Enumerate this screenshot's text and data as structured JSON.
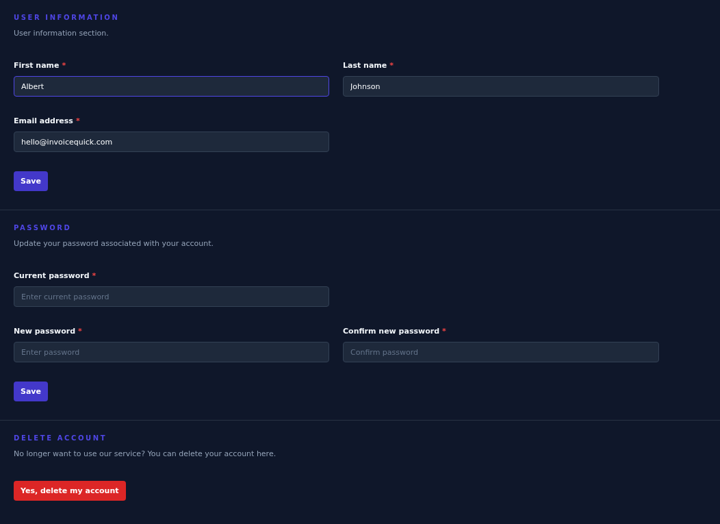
{
  "sections": [
    {
      "title": "USER INFORMATION",
      "description": "User information section.",
      "rows": [
        [
          {
            "label": "First name",
            "required_mark": "*",
            "value": "Albert",
            "focused": true
          },
          {
            "label": "Last name",
            "required_mark": "*",
            "value": "Johnson",
            "focused": false
          }
        ],
        [
          {
            "label": "Email address",
            "required_mark": "*",
            "value": "hello@invoicequick.com",
            "focused": false
          }
        ]
      ],
      "button": {
        "label": "Save",
        "kind": "primary"
      }
    },
    {
      "title": "PASSWORD",
      "description": "Update your password associated with your account.",
      "rows": [
        [
          {
            "label": "Current password",
            "required_mark": "*",
            "placeholder": "Enter current password",
            "focused": false
          }
        ],
        [
          {
            "label": "New password",
            "required_mark": "*",
            "placeholder": "Enter password",
            "focused": false
          },
          {
            "label": "Confirm new password",
            "required_mark": "*",
            "placeholder": "Confirm password",
            "focused": false
          }
        ]
      ],
      "button": {
        "label": "Save",
        "kind": "primary"
      }
    },
    {
      "title": "DELETE ACCOUNT",
      "description": "No longer want to use our service? You can delete your account here.",
      "button": {
        "label": "Yes, delete my account",
        "kind": "danger"
      }
    }
  ]
}
